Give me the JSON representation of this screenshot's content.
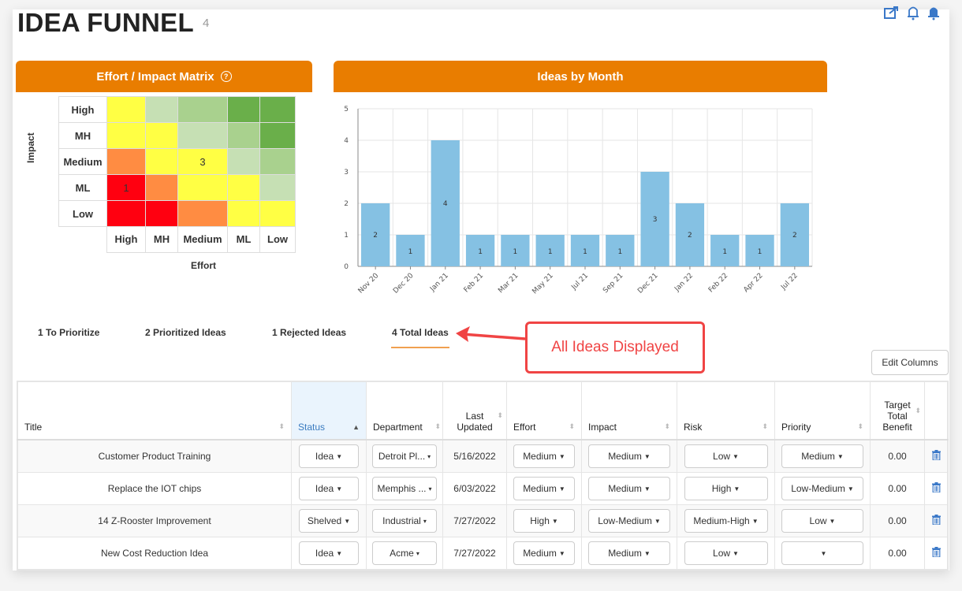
{
  "header": {
    "title": "IDEA FUNNEL",
    "count": "4",
    "icons": [
      "share-icon",
      "bell-outline-icon",
      "bell-filled-icon"
    ]
  },
  "matrix_panel": {
    "title": "Effort / Impact Matrix",
    "help_icon": "?",
    "impact_axis_label": "Impact",
    "effort_axis_label": "Effort",
    "row_labels": [
      "High",
      "MH",
      "Medium",
      "ML",
      "Low"
    ],
    "col_labels": [
      "High",
      "MH",
      "Medium",
      "ML",
      "Low"
    ],
    "cell_colors": [
      [
        "#ffff44",
        "#c6e0b4",
        "#a9d18e",
        "#6aaf4a",
        "#6aaf4a"
      ],
      [
        "#ffff44",
        "#ffff44",
        "#c6e0b4",
        "#a9d18e",
        "#6aaf4a"
      ],
      [
        "#ff8c42",
        "#ffff44",
        "#ffff44",
        "#c6e0b4",
        "#a9d18e"
      ],
      [
        "#ff0010",
        "#ff8c42",
        "#ffff44",
        "#ffff44",
        "#c6e0b4"
      ],
      [
        "#ff0010",
        "#ff0010",
        "#ff8c42",
        "#ffff44",
        "#ffff44"
      ]
    ],
    "cell_counts": [
      [
        "",
        "",
        "",
        "",
        ""
      ],
      [
        "",
        "",
        "",
        "",
        ""
      ],
      [
        "",
        "",
        "3",
        "",
        ""
      ],
      [
        "1",
        "",
        "",
        "",
        ""
      ],
      [
        "",
        "",
        "",
        "",
        ""
      ]
    ]
  },
  "chart_panel": {
    "title": "Ideas by Month"
  },
  "chart_data": {
    "type": "bar",
    "title": "Ideas by Month",
    "categories": [
      "Nov 20",
      "Dec 20",
      "Jan 21",
      "Feb 21",
      "Mar 21",
      "May 21",
      "Jul 21",
      "Sep 21",
      "Dec 21",
      "Jan 22",
      "Feb 22",
      "Apr 22",
      "Jul 22"
    ],
    "values": [
      2,
      1,
      4,
      1,
      1,
      1,
      1,
      1,
      3,
      2,
      1,
      1,
      2
    ],
    "xlabel": "",
    "ylabel": "",
    "ylim": [
      0,
      5
    ],
    "yticks": [
      0,
      1,
      2,
      3,
      4,
      5
    ],
    "grid": true,
    "bar_color": "#85c1e3",
    "data_labels": true
  },
  "tabs": [
    {
      "label": "1 To Prioritize",
      "active": false
    },
    {
      "label": "2 Prioritized Ideas",
      "active": false
    },
    {
      "label": "1 Rejected Ideas",
      "active": false
    },
    {
      "label": "4 Total Ideas",
      "active": true
    }
  ],
  "annotation": {
    "text": "All Ideas Displayed",
    "color": "#f04444"
  },
  "toolbar": {
    "edit_columns_label": "Edit Columns"
  },
  "table": {
    "columns": [
      "Title",
      "Status",
      "Department",
      "Last Updated",
      "Effort",
      "Impact",
      "Risk",
      "Priority",
      "Target Total Benefit",
      ""
    ],
    "sorted_column": "Status",
    "rows": [
      {
        "title": "Customer Product Training",
        "status": "Idea",
        "department": "Detroit Pl...",
        "last_updated": "5/16/2022",
        "effort": "Medium",
        "impact": "Medium",
        "risk": "Low",
        "priority": "Medium",
        "benefit": "0.00"
      },
      {
        "title": "Replace the IOT chips",
        "status": "Idea",
        "department": "Memphis ...",
        "last_updated": "6/03/2022",
        "effort": "Medium",
        "impact": "Medium",
        "risk": "High",
        "priority": "Low-Medium",
        "benefit": "0.00"
      },
      {
        "title": "14 Z-Rooster Improvement",
        "status": "Shelved",
        "department": "Industrial",
        "last_updated": "7/27/2022",
        "effort": "High",
        "impact": "Low-Medium",
        "risk": "Medium-High",
        "priority": "Low",
        "benefit": "0.00"
      },
      {
        "title": "New Cost Reduction Idea",
        "status": "Idea",
        "department": "Acme",
        "last_updated": "7/27/2022",
        "effort": "Medium",
        "impact": "Medium",
        "risk": "Low",
        "priority": "",
        "benefit": "0.00"
      }
    ]
  }
}
